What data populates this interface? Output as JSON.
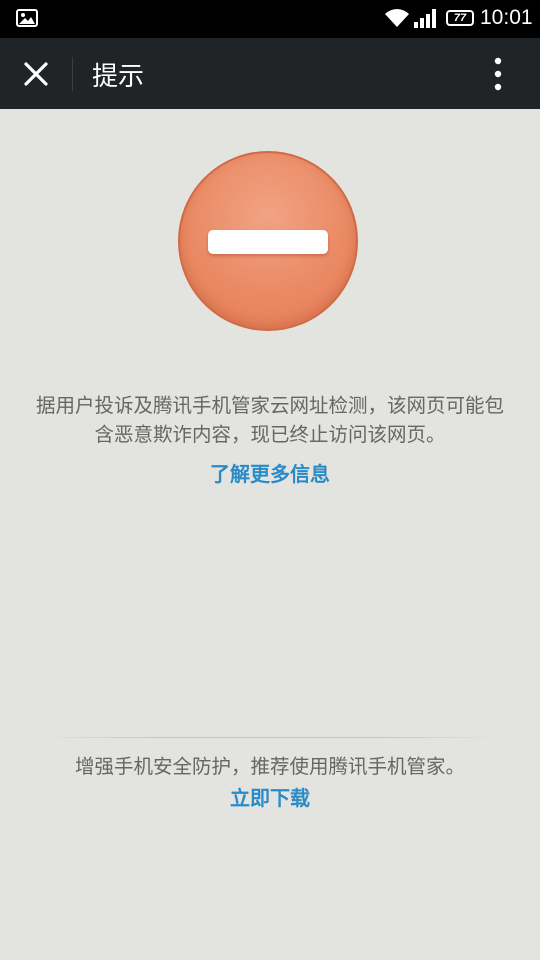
{
  "status_bar": {
    "battery_level": "77",
    "time": "10:01",
    "icons": [
      "gallery-icon",
      "wifi-icon",
      "signal-icon",
      "battery-icon"
    ]
  },
  "title_bar": {
    "title": "提示",
    "close_icon": "close-icon",
    "menu_icon": "more-vertical-icon"
  },
  "warning": {
    "icon": "no-entry-icon",
    "accent_color": "#e8845e",
    "message": "据用户投诉及腾讯手机管家云网址检测，该网页可能包含恶意欺诈内容，现已终止访问该网页。",
    "more_info_link": "了解更多信息"
  },
  "promo": {
    "text": "增强手机安全防护，推荐使用腾讯手机管家。",
    "download_link": "立即下载",
    "link_color": "#2b8bc8"
  }
}
